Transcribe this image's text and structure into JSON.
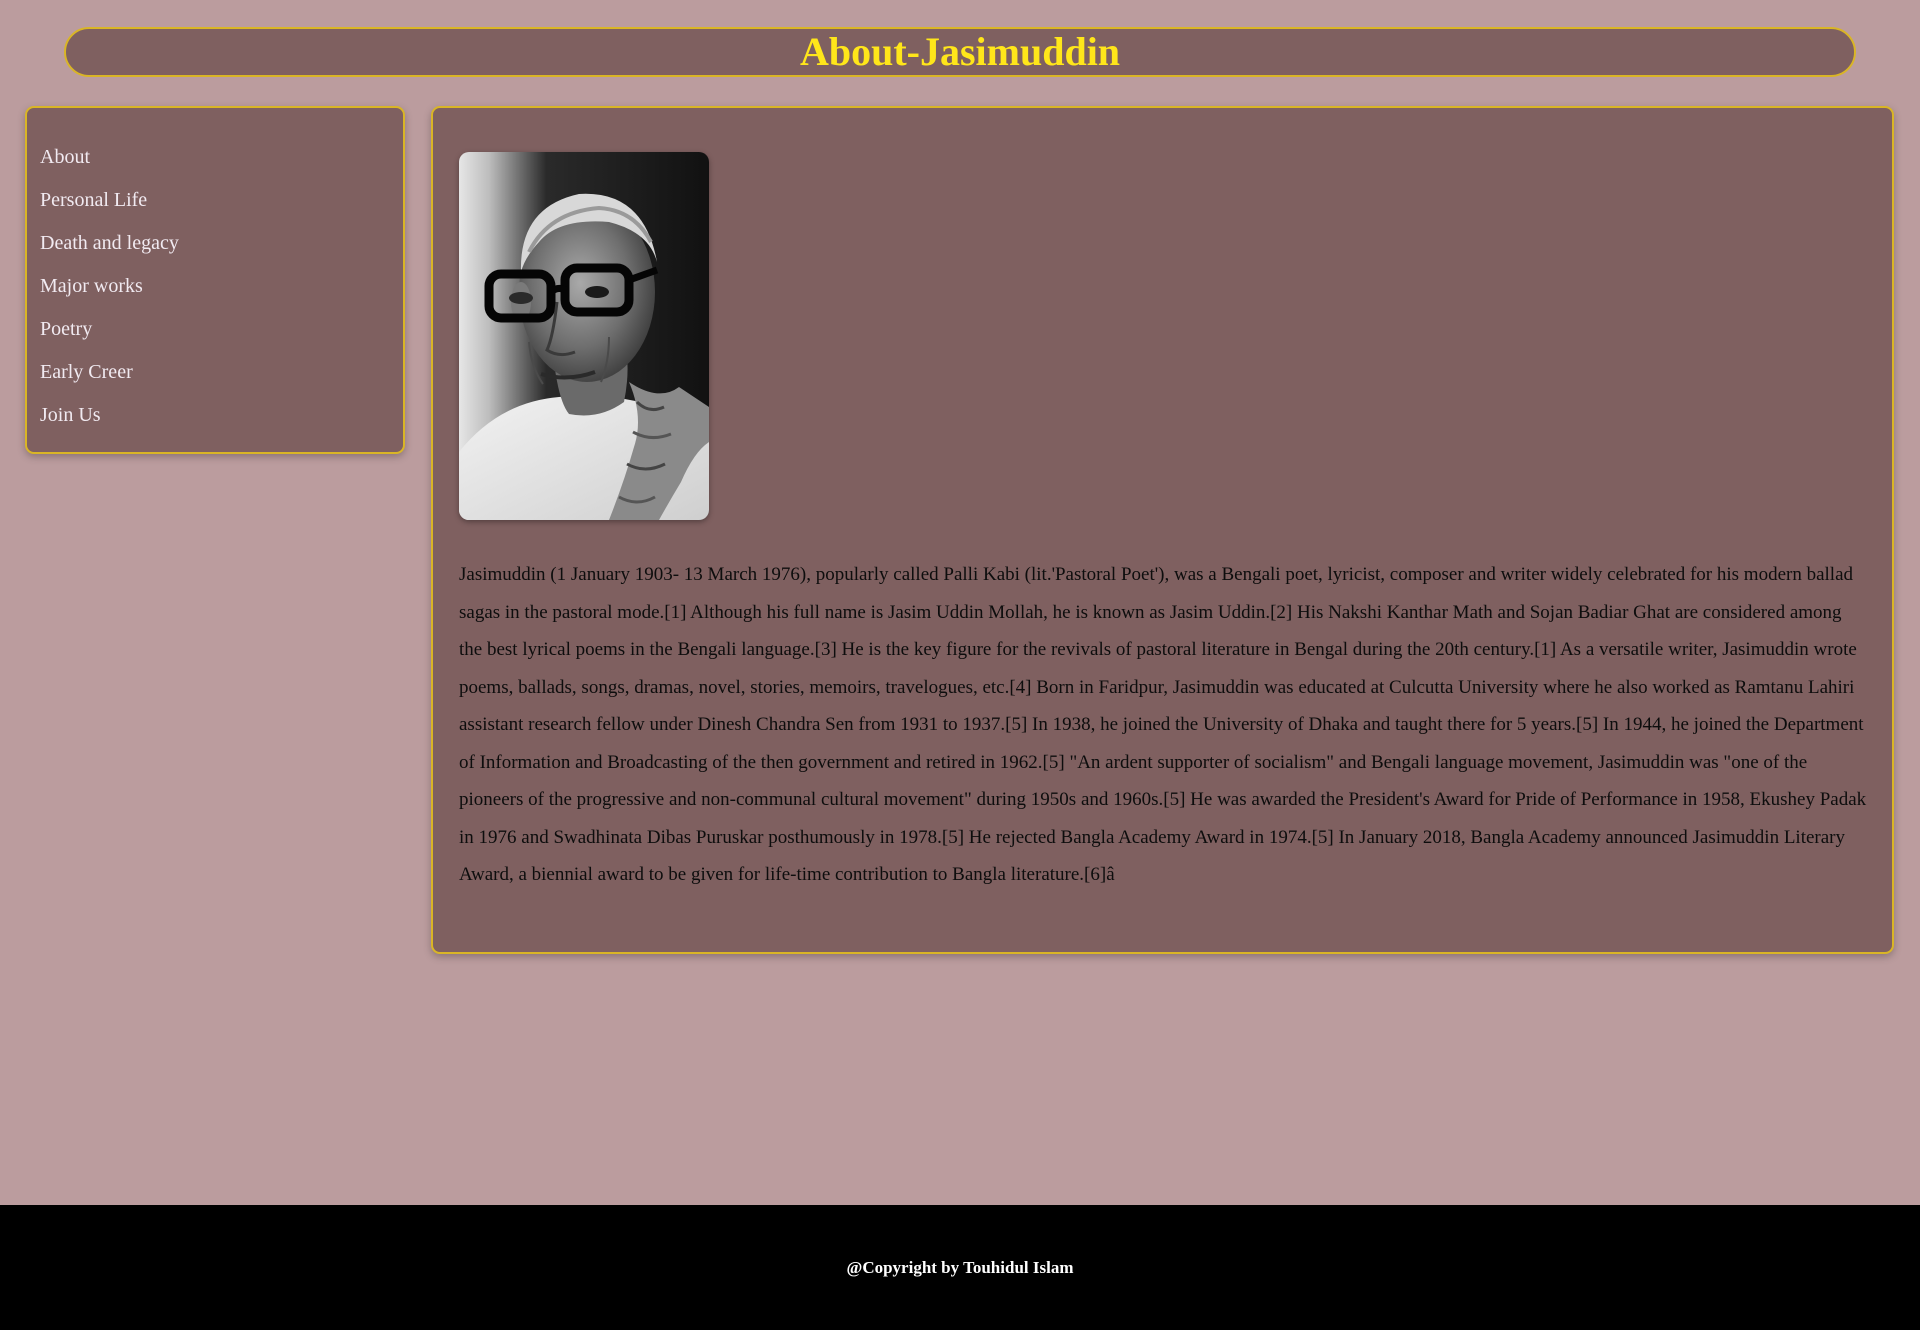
{
  "header": {
    "title": "About-Jasimuddin"
  },
  "sidebar": {
    "items": [
      {
        "label": "About"
      },
      {
        "label": "Personal Life"
      },
      {
        "label": "Death and legacy"
      },
      {
        "label": "Major works"
      },
      {
        "label": "Poetry"
      },
      {
        "label": "Early Creer"
      },
      {
        "label": "Join Us"
      }
    ]
  },
  "main": {
    "portrait_icon": "person-portrait-photo",
    "bio": "Jasimuddin (1 January 1903- 13 March 1976), popularly called Palli Kabi (lit.'Pastoral Poet'), was a Bengali poet, lyricist, composer and writer widely celebrated for his modern ballad sagas in the pastoral mode.[1] Although his full name is Jasim Uddin Mollah, he is known as Jasim Uddin.[2] His Nakshi Kanthar Math and Sojan Badiar Ghat are considered among the best lyrical poems in the Bengali language.[3] He is the key figure for the revivals of pastoral literature in Bengal during the 20th century.[1] As a versatile writer, Jasimuddin wrote poems, ballads, songs, dramas, novel, stories, memoirs, travelogues, etc.[4] Born in Faridpur, Jasimuddin was educated at Culcutta University where he also worked as Ramtanu Lahiri assistant research fellow under Dinesh Chandra Sen from 1931 to 1937.[5] In 1938, he joined the University of Dhaka and taught there for 5 years.[5] In 1944, he joined the Department of Information and Broadcasting of the then government and retired in 1962.[5] \"An ardent supporter of socialism\" and Bengali language movement, Jasimuddin was \"one of the pioneers of the progressive and non-communal cultural movement\" during 1950s and 1960s.[5] He was awarded the President's Award for Pride of Performance in 1958, Ekushey Padak in 1976 and Swadhinata Dibas Puruskar posthumously in 1978.[5] He rejected Bangla Academy Award in 1974.[5] In January 2018, Bangla Academy announced Jasimuddin Literary Award, a biennial award to be given for life-time contribution to Bangla literature.[6]â"
  },
  "footer": {
    "copyright": "@Copyright by Touhidul Islam"
  },
  "colors": {
    "page_background": "#bb9c9e",
    "panel_background": "#7f6060",
    "panel_border": "#d9b526",
    "title_color": "#ffe61a",
    "nav_text": "#f1eaf1",
    "footer_background": "#000000"
  }
}
